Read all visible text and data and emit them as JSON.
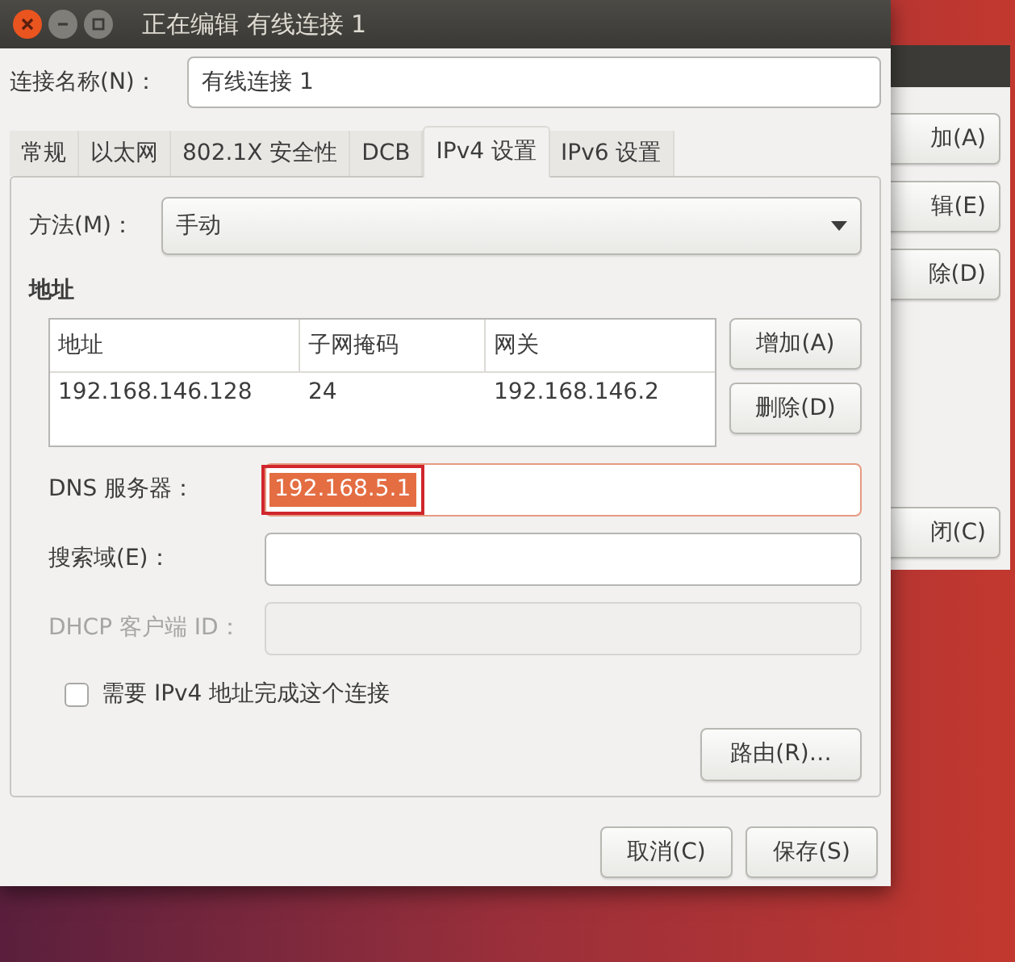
{
  "back_window": {
    "buttons": [
      "加(A)",
      "辑(E)",
      "除(D)",
      "闭(C)"
    ]
  },
  "window": {
    "title": "正在编辑 有线连接 1"
  },
  "connection_name": {
    "label": "连接名称(N)：",
    "value": "有线连接 1"
  },
  "tabs": [
    {
      "label": "常规",
      "selected": false
    },
    {
      "label": "以太网",
      "selected": false
    },
    {
      "label": "802.1X 安全性",
      "selected": false
    },
    {
      "label": "DCB",
      "selected": false
    },
    {
      "label": "IPv4 设置",
      "selected": true
    },
    {
      "label": "IPv6 设置",
      "selected": false
    }
  ],
  "method": {
    "label": "方法(M)：",
    "value": "手动"
  },
  "addresses": {
    "heading": "地址",
    "columns": [
      "地址",
      "子网掩码",
      "网关"
    ],
    "rows": [
      [
        "192.168.146.128",
        "24",
        "192.168.146.2"
      ]
    ],
    "buttons": [
      "增加(A)",
      "删除(D)"
    ]
  },
  "fields": [
    {
      "label": "DNS 服务器：",
      "value": "192.168.5.1",
      "highlighted": true,
      "disabled": false
    },
    {
      "label": "搜索域(E)：",
      "disabled": false
    },
    {
      "label": "DHCP 客户端 ID：",
      "disabled": true
    }
  ],
  "require_ipv4": {
    "label": "需要 IPv4 地址完成这个连接",
    "checked": false
  },
  "routes_button": "路由(R)…",
  "buttons": [
    "取消(C)",
    "保存(S)"
  ]
}
